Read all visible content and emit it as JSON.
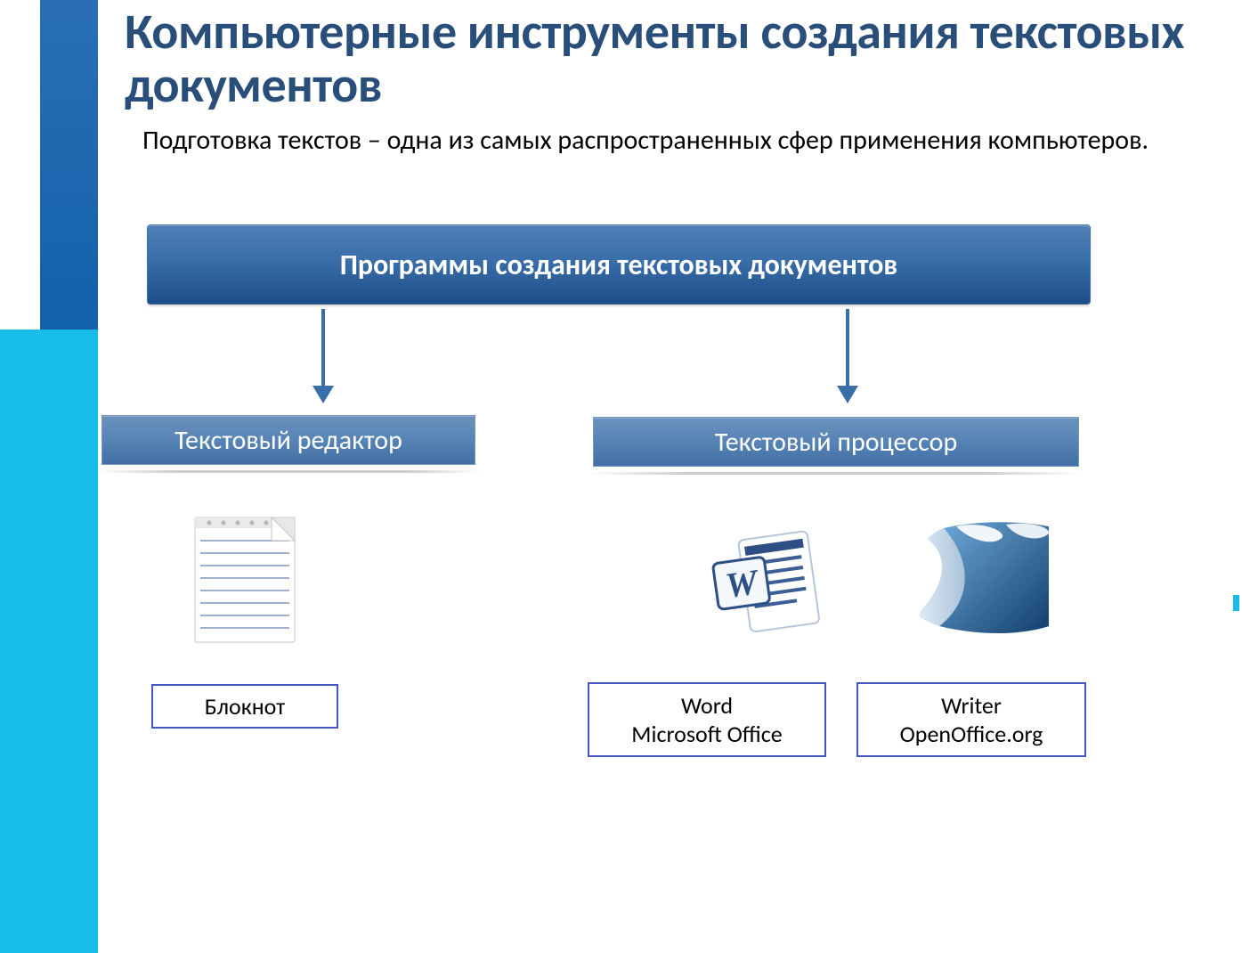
{
  "colors": {
    "title": "#294e79",
    "sidebar_top": "#1261ab",
    "sidebar_bottom": "#18bde9",
    "banner_grad_top": "#4f7fb5",
    "banner_grad_bottom": "#1c4e87",
    "label_border": "#4656c0"
  },
  "title": "Компьютерные инструменты создания текстовых документов",
  "subtitle": "Подготовка текстов – одна из самых распространенных сфер применения компьютеров.",
  "banner": "Программы создания текстовых документов",
  "categories": {
    "left": "Текстовый редактор",
    "right": "Текстовый процессор"
  },
  "apps": {
    "notepad": {
      "label": "Блокнот",
      "icon": "notepad-icon"
    },
    "word": {
      "label": "Word\nMicrosoft Office",
      "icon": "ms-word-icon"
    },
    "writer": {
      "label": "Writer\nOpenOffice.org",
      "icon": "openoffice-icon"
    }
  }
}
